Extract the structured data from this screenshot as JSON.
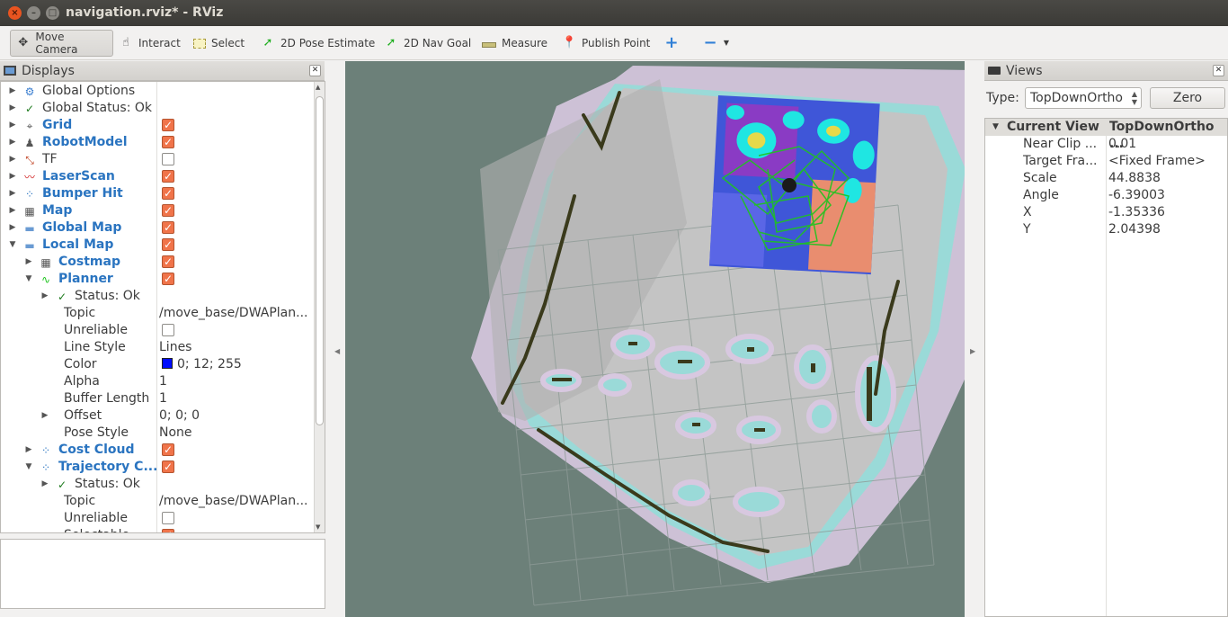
{
  "window": {
    "title": "navigation.rviz* - RViz",
    "close": "×",
    "minimize": "–",
    "maximize": "□"
  },
  "toolbar": {
    "move_camera": "Move Camera",
    "interact": "Interact",
    "select": "Select",
    "pose_estimate": "2D Pose Estimate",
    "nav_goal": "2D Nav Goal",
    "measure": "Measure",
    "publish_point": "Publish Point"
  },
  "displays": {
    "title": "Displays",
    "rows": [
      {
        "label": "Global Options",
        "value": ""
      },
      {
        "label": "Global Status: Ok",
        "value": ""
      },
      {
        "label": "Grid",
        "value": ""
      },
      {
        "label": "RobotModel",
        "value": ""
      },
      {
        "label": "TF",
        "value": ""
      },
      {
        "label": "LaserScan",
        "value": ""
      },
      {
        "label": "Bumper Hit",
        "value": ""
      },
      {
        "label": "Map",
        "value": ""
      },
      {
        "label": "Global Map",
        "value": ""
      },
      {
        "label": "Local Map",
        "value": ""
      },
      {
        "label": "Costmap",
        "value": ""
      },
      {
        "label": "Planner",
        "value": ""
      },
      {
        "label": "Status: Ok",
        "value": ""
      },
      {
        "label": "Topic",
        "value": "/move_base/DWAPlan..."
      },
      {
        "label": "Unreliable",
        "value": ""
      },
      {
        "label": "Line Style",
        "value": "Lines"
      },
      {
        "label": "Color",
        "value": "0; 12; 255"
      },
      {
        "label": "Alpha",
        "value": "1"
      },
      {
        "label": "Buffer Length",
        "value": "1"
      },
      {
        "label": "Offset",
        "value": "0; 0; 0"
      },
      {
        "label": "Pose Style",
        "value": "None"
      },
      {
        "label": "Cost Cloud",
        "value": ""
      },
      {
        "label": "Trajectory C...",
        "value": ""
      },
      {
        "label": "Status: Ok",
        "value": ""
      },
      {
        "label": "Topic",
        "value": "/move_base/DWAPlan..."
      },
      {
        "label": "Unreliable",
        "value": ""
      },
      {
        "label": "Selectable",
        "value": ""
      }
    ],
    "checked": [
      false,
      false,
      true,
      true,
      false,
      true,
      true,
      true,
      true,
      true,
      true,
      true,
      false,
      false,
      false,
      false,
      false,
      false,
      false,
      false,
      false,
      true,
      true,
      false,
      false,
      false,
      true
    ],
    "planner_color": "#000cff"
  },
  "views": {
    "title": "Views",
    "type_label": "Type:",
    "type_value": "TopDownOrtho",
    "zero_button": "Zero",
    "header_key": "Current View",
    "header_value": "TopDownOrtho ...",
    "rows": [
      {
        "k": "Near Clip ...",
        "v": "0.01"
      },
      {
        "k": "Target Fra...",
        "v": "<Fixed Frame>"
      },
      {
        "k": "Scale",
        "v": "44.8838"
      },
      {
        "k": "Angle",
        "v": "-6.39003"
      },
      {
        "k": "X",
        "v": "-1.35336"
      },
      {
        "k": "Y",
        "v": "2.04398"
      }
    ]
  }
}
